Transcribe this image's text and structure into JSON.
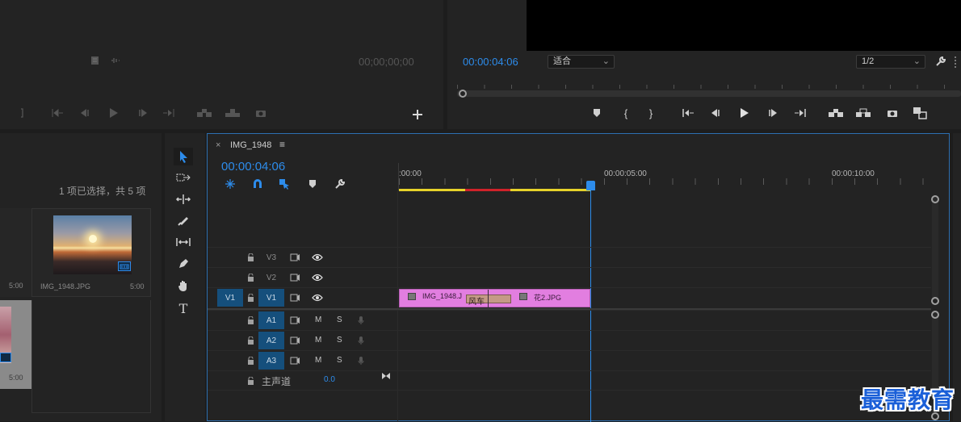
{
  "source_monitor": {
    "timecode": "00;00;00;00"
  },
  "program_monitor": {
    "timecode": "00:00:04:06",
    "fit_select": "适合",
    "resolution_select": "1/2"
  },
  "project_panel": {
    "selection_info": "1 项已选择，共 5 项",
    "items": [
      {
        "name": "",
        "duration": "5:00"
      },
      {
        "name": "IMG_1948.JPG",
        "duration": "5:00"
      },
      {
        "name": "",
        "duration": "5:00"
      }
    ]
  },
  "timeline": {
    "close_glyph": "×",
    "sequence_name": "IMG_1948",
    "menu_glyph": "≡",
    "timecode": "00:00:04:06",
    "ruler": {
      "labels": [
        ":00:00",
        "00:00:05:00",
        "00:00:10:00"
      ]
    },
    "tracks": {
      "video": [
        {
          "name": "V3",
          "source": ""
        },
        {
          "name": "V2",
          "source": ""
        },
        {
          "name": "V1",
          "source": "V1"
        }
      ],
      "audio": [
        {
          "name": "A1",
          "m": "M",
          "s": "S"
        },
        {
          "name": "A2",
          "m": "M",
          "s": "S"
        },
        {
          "name": "A3",
          "m": "M",
          "s": "S"
        }
      ],
      "master": {
        "name": "主声道",
        "value": "0.0"
      }
    },
    "clips": [
      {
        "name": "IMG_1948.J"
      },
      {
        "name": "风车"
      },
      {
        "name": "花2.JPG"
      }
    ]
  },
  "watermark": {
    "text": "最需教育"
  },
  "colors": {
    "accent": "#2d8ceb",
    "clip": "#e27ee0",
    "transition": "#c49a86"
  }
}
